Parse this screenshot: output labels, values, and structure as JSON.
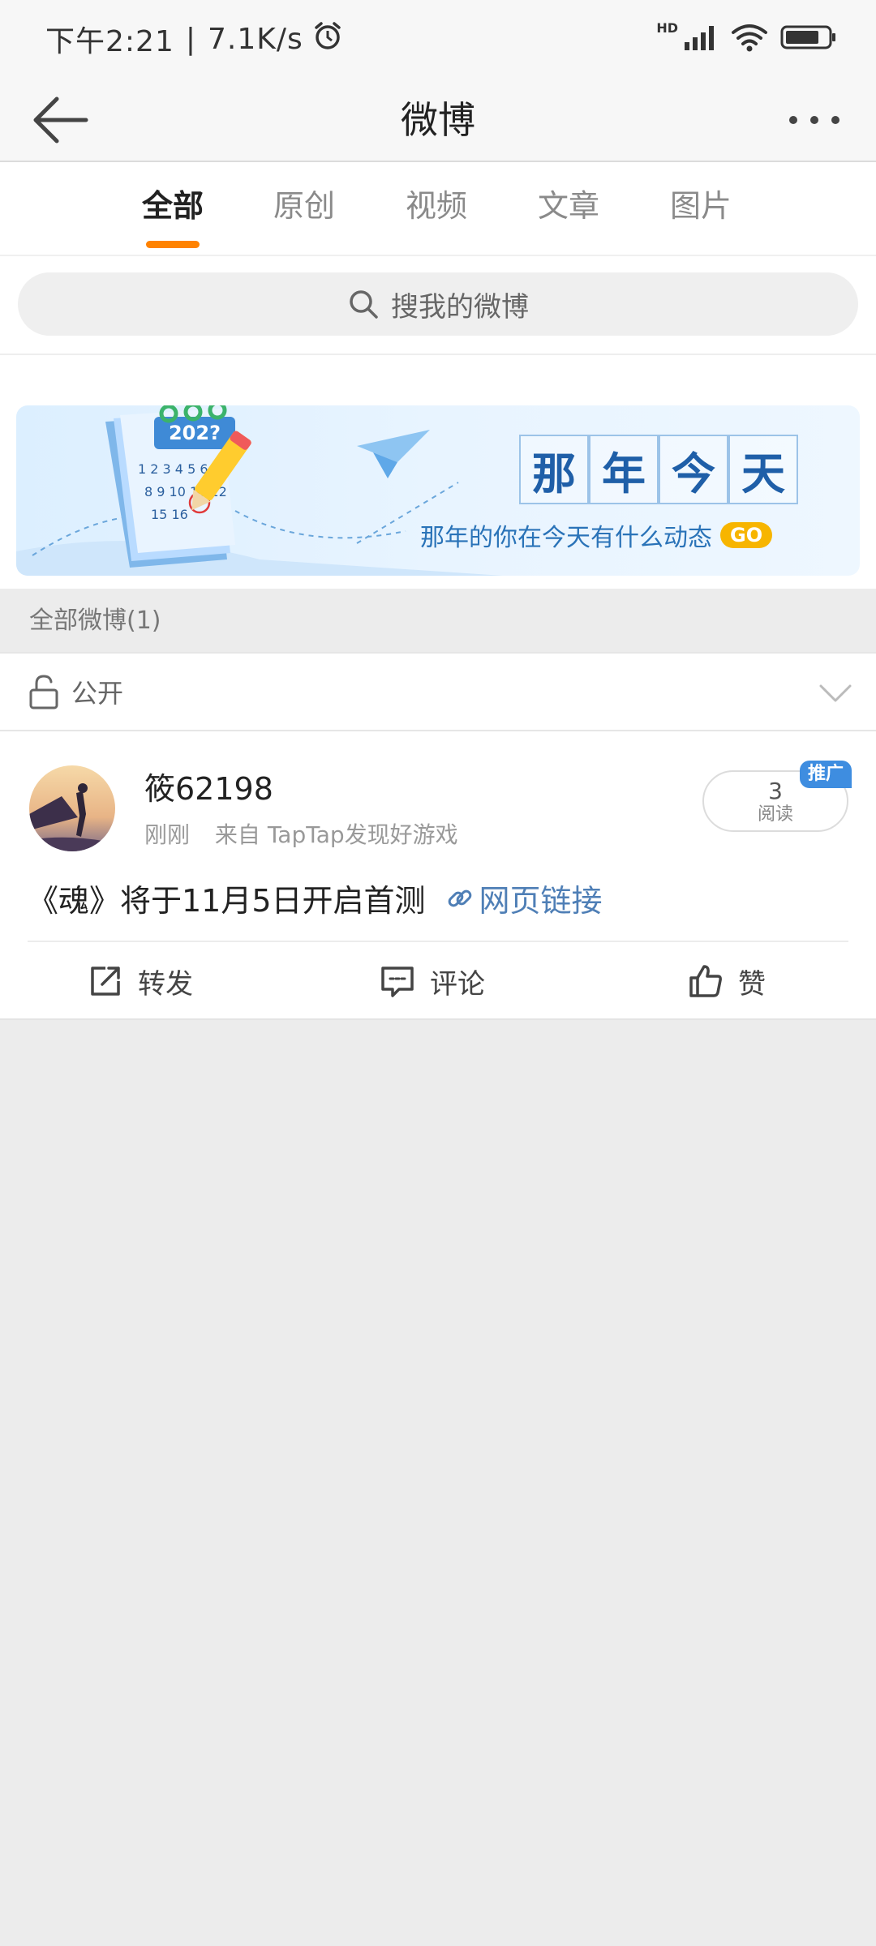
{
  "status_bar": {
    "time": "下午2:21",
    "network_speed": "7.1K/s",
    "hd_label": "HD",
    "icons": [
      "alarm-icon",
      "signal-icon",
      "wifi-icon",
      "battery-icon"
    ]
  },
  "nav": {
    "title": "微博",
    "back_icon": "back-arrow-icon",
    "more_icon": "more-icon"
  },
  "tabs": [
    {
      "label": "全部",
      "active": true
    },
    {
      "label": "原创",
      "active": false
    },
    {
      "label": "视频",
      "active": false
    },
    {
      "label": "文章",
      "active": false
    },
    {
      "label": "图片",
      "active": false
    }
  ],
  "search": {
    "placeholder": "搜我的微博"
  },
  "banner": {
    "title_chars": [
      "那",
      "年",
      "今",
      "天"
    ],
    "subtitle": "那年的你在今天有什么动态",
    "go_label": "GO",
    "calendar_year": "202?"
  },
  "section_header": "全部微博(1)",
  "visibility": {
    "label": "公开"
  },
  "post": {
    "username": "筱62198",
    "time": "刚刚",
    "source": "来自 TapTap发现好游戏",
    "read_count": "3",
    "read_label": "阅读",
    "promo_tag": "推广",
    "text": "《魂》将于11月5日开启首测",
    "link_label": "网页链接",
    "actions": {
      "repost": "转发",
      "comment": "评论",
      "like": "赞"
    }
  },
  "colors": {
    "accent": "#ff8200",
    "link": "#4f7fb6",
    "promo": "#3e8de0",
    "go": "#f7b500",
    "background": "#ececec"
  }
}
